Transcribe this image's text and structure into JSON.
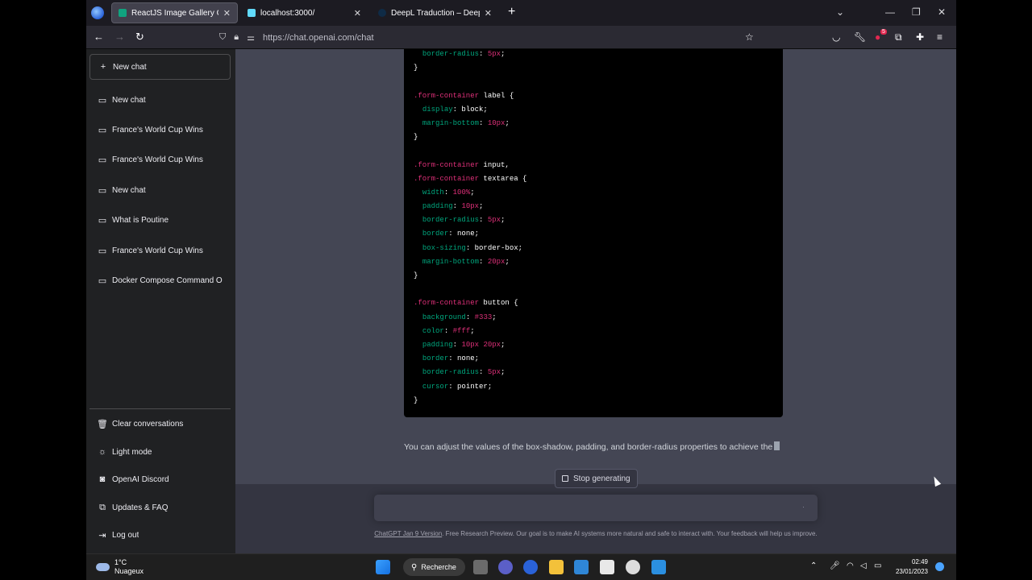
{
  "tabs": [
    {
      "title": "ReactJS Image Gallery Code.",
      "active": true,
      "favicon_color": "#10a37f"
    },
    {
      "title": "localhost:3000/",
      "active": false,
      "favicon_color": "#61dafb"
    },
    {
      "title": "DeepL Traduction – DeepL Tran",
      "active": false,
      "favicon_color": "#0f2b46"
    }
  ],
  "navbar": {
    "url": "https://chat.openai.com/chat",
    "extension_badge": "5"
  },
  "sidebar": {
    "new_chat_button": "New chat",
    "conversations": [
      "New chat",
      "France's World Cup Wins",
      "France's World Cup Wins",
      "New chat",
      "What is Poutine",
      "France's World Cup Wins",
      "Docker Compose Command O"
    ],
    "bottom": [
      "Clear conversations",
      "Light mode",
      "OpenAI Discord",
      "Updates & FAQ",
      "Log out"
    ]
  },
  "code_lines": [
    [
      [
        "  ",
        "txt"
      ],
      [
        "border-radius",
        "prop"
      ],
      [
        ": ",
        "txt"
      ],
      [
        "5px",
        "num"
      ],
      [
        ";",
        "txt"
      ]
    ],
    [
      [
        "}",
        "txt"
      ]
    ],
    [
      [
        "",
        "txt"
      ]
    ],
    [
      [
        ".form-container",
        "sel"
      ],
      [
        " label {",
        "txt"
      ]
    ],
    [
      [
        "  ",
        "txt"
      ],
      [
        "display",
        "prop"
      ],
      [
        ": block;",
        "txt"
      ]
    ],
    [
      [
        "  ",
        "txt"
      ],
      [
        "margin-bottom",
        "prop"
      ],
      [
        ": ",
        "txt"
      ],
      [
        "10px",
        "num"
      ],
      [
        ";",
        "txt"
      ]
    ],
    [
      [
        "}",
        "txt"
      ]
    ],
    [
      [
        "",
        "txt"
      ]
    ],
    [
      [
        ".form-container",
        "sel"
      ],
      [
        " input,",
        "txt"
      ]
    ],
    [
      [
        ".form-container",
        "sel"
      ],
      [
        " textarea {",
        "txt"
      ]
    ],
    [
      [
        "  ",
        "txt"
      ],
      [
        "width",
        "prop"
      ],
      [
        ": ",
        "txt"
      ],
      [
        "100%",
        "num"
      ],
      [
        ";",
        "txt"
      ]
    ],
    [
      [
        "  ",
        "txt"
      ],
      [
        "padding",
        "prop"
      ],
      [
        ": ",
        "txt"
      ],
      [
        "10px",
        "num"
      ],
      [
        ";",
        "txt"
      ]
    ],
    [
      [
        "  ",
        "txt"
      ],
      [
        "border-radius",
        "prop"
      ],
      [
        ": ",
        "txt"
      ],
      [
        "5px",
        "num"
      ],
      [
        ";",
        "txt"
      ]
    ],
    [
      [
        "  ",
        "txt"
      ],
      [
        "border",
        "prop"
      ],
      [
        ": none;",
        "txt"
      ]
    ],
    [
      [
        "  ",
        "txt"
      ],
      [
        "box-sizing",
        "prop"
      ],
      [
        ": border-box;",
        "txt"
      ]
    ],
    [
      [
        "  ",
        "txt"
      ],
      [
        "margin-bottom",
        "prop"
      ],
      [
        ": ",
        "txt"
      ],
      [
        "20px",
        "num"
      ],
      [
        ";",
        "txt"
      ]
    ],
    [
      [
        "}",
        "txt"
      ]
    ],
    [
      [
        "",
        "txt"
      ]
    ],
    [
      [
        ".form-container",
        "sel"
      ],
      [
        " button {",
        "txt"
      ]
    ],
    [
      [
        "  ",
        "txt"
      ],
      [
        "background",
        "prop"
      ],
      [
        ": ",
        "txt"
      ],
      [
        "#333",
        "num"
      ],
      [
        ";",
        "txt"
      ]
    ],
    [
      [
        "  ",
        "txt"
      ],
      [
        "color",
        "prop"
      ],
      [
        ": ",
        "txt"
      ],
      [
        "#fff",
        "num"
      ],
      [
        ";",
        "txt"
      ]
    ],
    [
      [
        "  ",
        "txt"
      ],
      [
        "padding",
        "prop"
      ],
      [
        ": ",
        "txt"
      ],
      [
        "10px 20px",
        "num"
      ],
      [
        ";",
        "txt"
      ]
    ],
    [
      [
        "  ",
        "txt"
      ],
      [
        "border",
        "prop"
      ],
      [
        ": none;",
        "txt"
      ]
    ],
    [
      [
        "  ",
        "txt"
      ],
      [
        "border-radius",
        "prop"
      ],
      [
        ": ",
        "txt"
      ],
      [
        "5px",
        "num"
      ],
      [
        ";",
        "txt"
      ]
    ],
    [
      [
        "  ",
        "txt"
      ],
      [
        "cursor",
        "prop"
      ],
      [
        ": pointer;",
        "txt"
      ]
    ],
    [
      [
        "}",
        "txt"
      ]
    ]
  ],
  "reply_text": "You can adjust the values of the box-shadow, padding, and border-radius properties to achieve the",
  "stop_button": "Stop generating",
  "footer": {
    "link": "ChatGPT Jan 9 Version",
    "text": ". Free Research Preview. Our goal is to make AI systems more natural and safe to interact with. Your feedback will help us improve."
  },
  "taskbar": {
    "temperature": "1°C",
    "weather": "Nuageux",
    "search_label": "Recherche",
    "time": "02:49",
    "date": "23/01/2023"
  }
}
